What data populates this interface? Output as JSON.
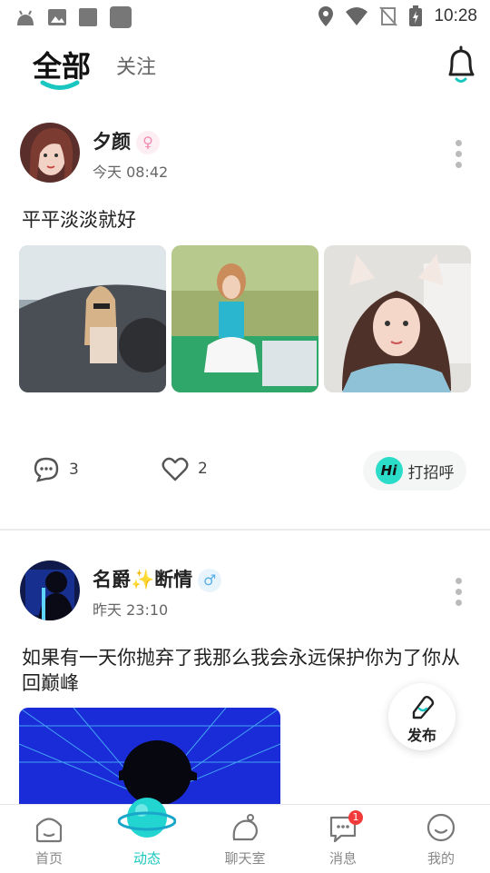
{
  "status_bar": {
    "time": "10:28"
  },
  "top_tabs": {
    "all": "全部",
    "following": "关注"
  },
  "posts": [
    {
      "username": "夕颜",
      "gender": "female",
      "gender_symbol": "♀",
      "time": "今天 08:42",
      "text": "平平淡淡就好",
      "photos": [
        "photo-in-car",
        "photo-golf-range",
        "photo-cat-ears"
      ],
      "comments": "3",
      "likes": "2",
      "greet_label": "打招呼",
      "greet_badge": "Hi"
    },
    {
      "username": "名爵✨断情",
      "gender": "male",
      "gender_symbol": "♂",
      "time": "昨天 23:10",
      "text_line1": "如果有一天你抛弃了我那么我会永远保护你为了你从",
      "text_line2": "回巅峰",
      "photos": [
        "photo-neon-grid"
      ]
    }
  ],
  "publish_button": {
    "label": "发布"
  },
  "bottom_nav": {
    "items": [
      {
        "label": "首页"
      },
      {
        "label": "动态",
        "active": true
      },
      {
        "label": "聊天室"
      },
      {
        "label": "消息",
        "badge": "1"
      },
      {
        "label": "我的"
      }
    ]
  },
  "colors": {
    "accent": "#19c7c0",
    "badge": "#f23a3a",
    "female": "#f08bb1",
    "male": "#58aee8"
  }
}
